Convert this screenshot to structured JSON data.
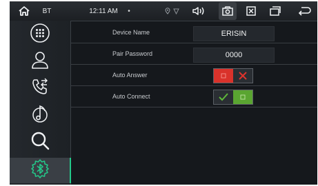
{
  "statusbar": {
    "home_icon": "home-icon",
    "bt_label": "BT",
    "time": "12:11 AM",
    "dot": "•"
  },
  "sidebar": {
    "items": [
      {
        "name": "sidebar-item-dialpad",
        "icon": "dialpad-icon"
      },
      {
        "name": "sidebar-item-contacts",
        "icon": "person-icon"
      },
      {
        "name": "sidebar-item-call-log",
        "icon": "call-transfer-icon"
      },
      {
        "name": "sidebar-item-music",
        "icon": "music-note-icon"
      },
      {
        "name": "sidebar-item-search",
        "icon": "search-icon"
      },
      {
        "name": "sidebar-item-bluetooth-settings",
        "icon": "bluetooth-gear-icon",
        "active": true
      }
    ]
  },
  "settings": {
    "device_name_label": "Device Name",
    "device_name_value": "ERISIN",
    "pair_password_label": "Pair Password",
    "pair_password_value": "0000",
    "auto_answer_label": "Auto Answer",
    "auto_answer_on": false,
    "auto_connect_label": "Auto Connect",
    "auto_connect_on": true
  },
  "colors": {
    "accent": "#23c98a",
    "toggle_off": "#d9322b",
    "toggle_on": "#5aa531"
  }
}
